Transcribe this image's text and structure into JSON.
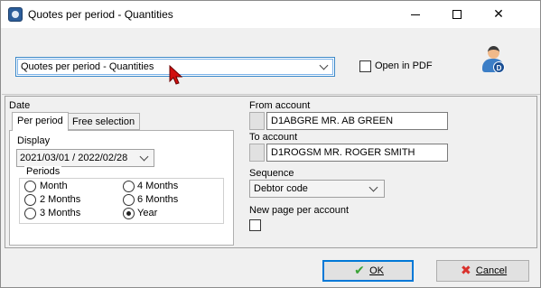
{
  "window": {
    "title": "Quotes per period - Quantities",
    "controls": {
      "minimize_icon": "minimize-icon",
      "maximize_icon": "maximize-icon",
      "close_icon": "close-icon"
    }
  },
  "topbar": {
    "report_select": {
      "value": "Quotes per period - Quantities"
    },
    "open_in_pdf": {
      "label": "Open in PDF",
      "checked": false
    },
    "user_icon": "user-badge-icon",
    "user_badge_letter": "D"
  },
  "date": {
    "section_label": "Date",
    "tabs": [
      {
        "label": "Per period",
        "active": true
      },
      {
        "label": "Free selection",
        "active": false
      }
    ],
    "display_label": "Display",
    "display_value": "2021/03/01 / 2022/02/28",
    "periods_label": "Periods",
    "periods": [
      {
        "label": "Month",
        "selected": false
      },
      {
        "label": "2 Months",
        "selected": false
      },
      {
        "label": "3 Months",
        "selected": false
      },
      {
        "label": "4 Months",
        "selected": false
      },
      {
        "label": "6 Months",
        "selected": false
      },
      {
        "label": "Year",
        "selected": true
      }
    ]
  },
  "accounts": {
    "from_label": "From account",
    "from_value": "D1ABGRE MR. AB GREEN",
    "to_label": "To account",
    "to_value": "D1ROGSM MR. ROGER SMITH"
  },
  "sequence": {
    "label": "Sequence",
    "value": "Debtor code"
  },
  "new_page": {
    "label": "New page per account",
    "checked": false
  },
  "buttons": {
    "ok": {
      "label": "OK",
      "icon": "checkmark-icon",
      "color": "#3aa335"
    },
    "cancel": {
      "label": "Cancel",
      "icon": "x-icon",
      "color": "#d9312c"
    }
  },
  "colors": {
    "focus": "#0078d7",
    "select_border": "#3b88c8",
    "cursor": "#d10f0f"
  }
}
